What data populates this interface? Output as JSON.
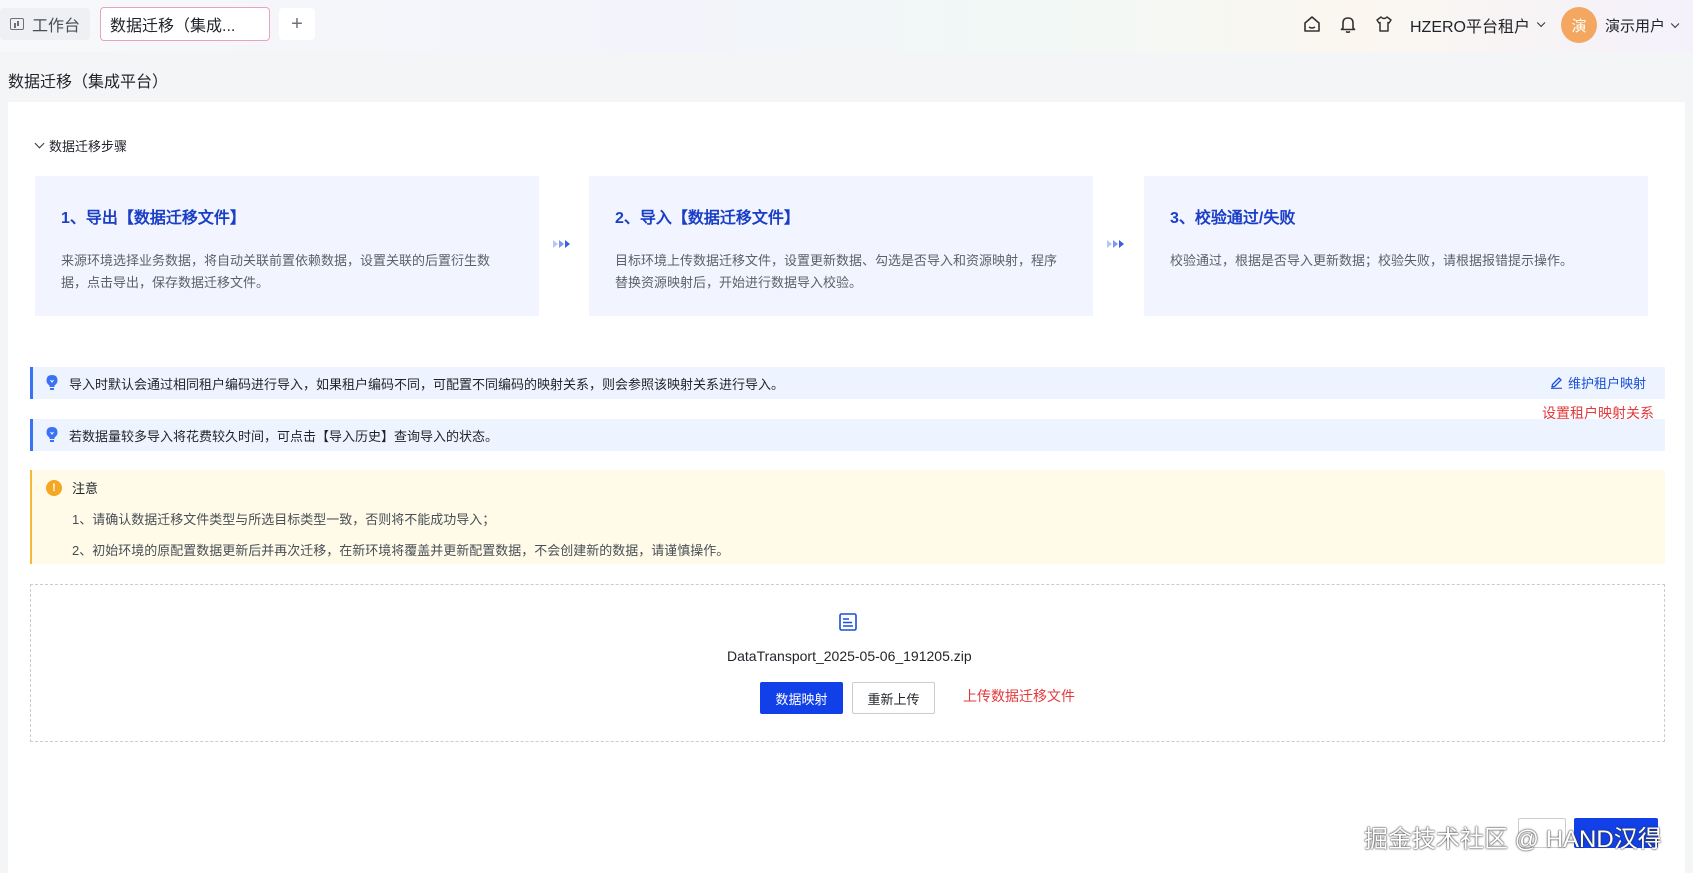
{
  "header": {
    "home_tab": "工作台",
    "active_tab": "数据迁移（集成...",
    "add_tab": "+",
    "tenant": "HZERO平台租户",
    "avatar_text": "演",
    "username": "演示用户"
  },
  "page": {
    "title": "数据迁移（集成平台）"
  },
  "steps_panel": {
    "heading": "数据迁移步骤",
    "steps": [
      {
        "title": "1、导出【数据迁移文件】",
        "desc": "来源环境选择业务数据，将自动关联前置依赖数据，设置关联的后置衍生数据，点击导出，保存数据迁移文件。"
      },
      {
        "title": "2、导入【数据迁移文件】",
        "desc": "目标环境上传数据迁移文件，设置更新数据、勾选是否导入和资源映射，程序替换资源映射后，开始进行数据导入校验。"
      },
      {
        "title": "3、校验通过/失败",
        "desc": "校验通过，根据是否导入更新数据；校验失败，请根据报错提示操作。"
      }
    ]
  },
  "info": [
    {
      "text": "导入时默认会通过相同租户编码进行导入，如果租户编码不同，可配置不同编码的映射关系，则会参照该映射关系进行导入。"
    },
    {
      "text": "若数据量较多导入将花费较久时间，可点击【导入历史】查询导入的状态。"
    }
  ],
  "maintain_link": "维护租户映射",
  "annotation_tenant": "设置租户映射关系",
  "warning": {
    "title": "注意",
    "icon_text": "!",
    "lines": [
      "1、请确认数据迁移文件类型与所选目标类型一致，否则将不能成功导入；",
      "2、初始环境的原配置数据更新后并再次迁移，在新环境将覆盖并更新配置数据，不会创建新的数据，请谨慎操作。"
    ]
  },
  "upload": {
    "file_name": "DataTransport_2025-05-06_191205.zip",
    "primary_button": "数据映射",
    "secondary_button": "重新上传",
    "annotation": "上传数据迁移文件"
  },
  "watermark": "掘金技术社区 @ HAND汉得",
  "colors": {
    "accent": "#1140e8",
    "step_title": "#1a3fc6",
    "info_border": "#3a72f6",
    "warning": "#f5a623",
    "annotation_red": "#e2393c"
  }
}
